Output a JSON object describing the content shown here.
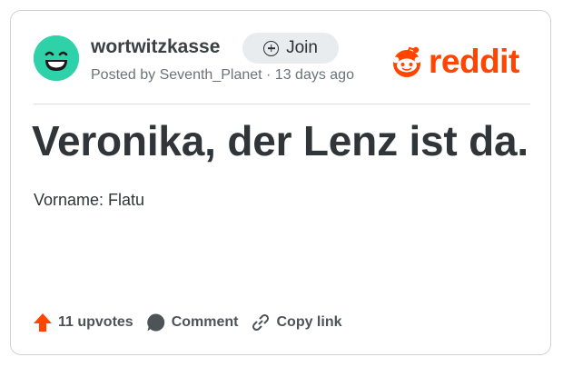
{
  "post": {
    "subreddit": "wortwitzkasse",
    "join_label": "Join",
    "posted_by": "Posted by Seventh_Planet · 13 days ago",
    "title": "Veronika, der Lenz ist da.",
    "body": "Vorname: Flatu"
  },
  "brand": {
    "logo_text": "reddit",
    "accent": "#ff4500",
    "avatar_color": "#2fd1a8"
  },
  "actions": {
    "upvotes": "11 upvotes",
    "comment": "Comment",
    "copy_link": "Copy link"
  },
  "icons": [
    "smiley-avatar-icon",
    "plus-circle-icon",
    "reddit-logo-icon",
    "upvote-arrow-icon",
    "comment-bubble-icon",
    "link-icon"
  ]
}
